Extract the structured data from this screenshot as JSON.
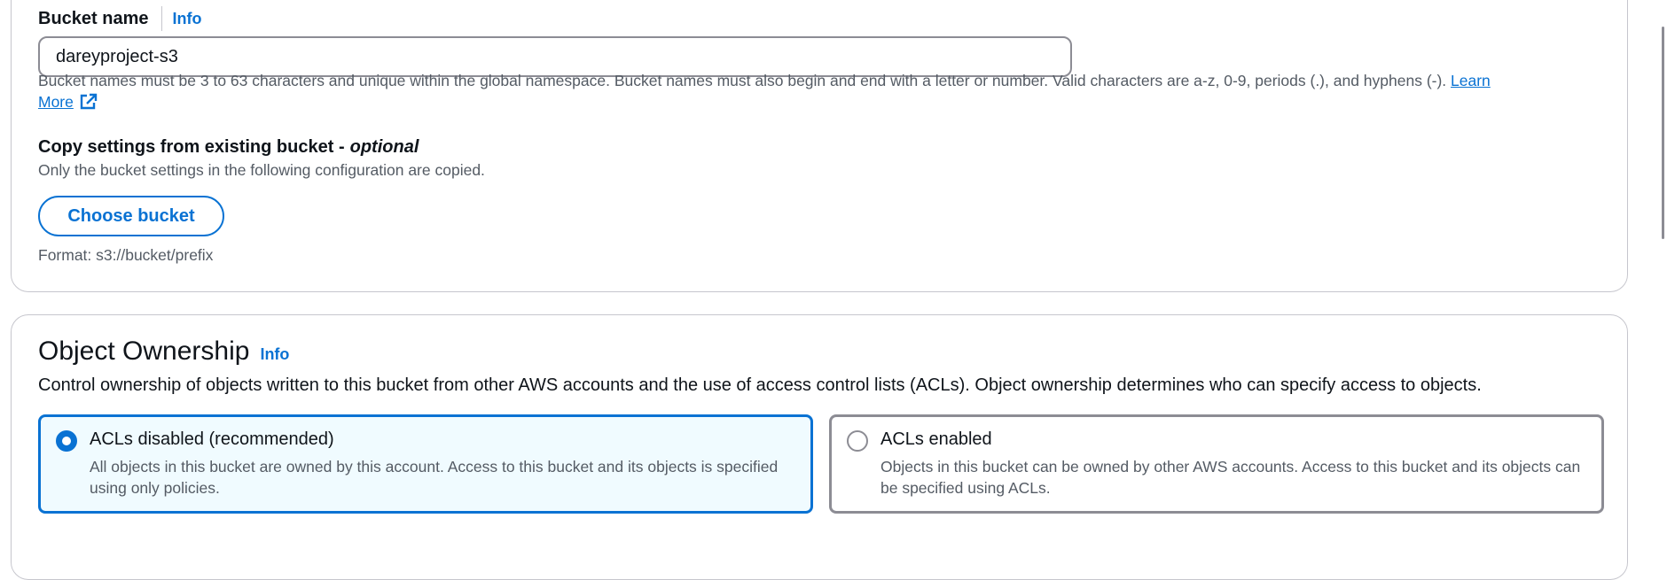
{
  "bucket_name": {
    "label": "Bucket name",
    "info": "Info",
    "value": "dareyproject-s3",
    "help_text": "Bucket names must be 3 to 63 characters and unique within the global namespace. Bucket names must also begin and end with a letter or number. Valid characters are a-z, 0-9, periods (.), and hyphens (-). ",
    "learn_more_1": "Learn",
    "learn_more_2": "More"
  },
  "copy_settings": {
    "label": "Copy settings from existing bucket - ",
    "label_optional": "optional",
    "description": "Only the bucket settings in the following configuration are copied.",
    "button": "Choose bucket",
    "format_hint": "Format: s3://bucket/prefix"
  },
  "object_ownership": {
    "title": "Object Ownership",
    "info": "Info",
    "description": "Control ownership of objects written to this bucket from other AWS accounts and the use of access control lists (ACLs). Object ownership determines who can specify access to objects.",
    "options": [
      {
        "title": "ACLs disabled (recommended)",
        "description": "All objects in this bucket are owned by this account. Access to this bucket and its objects is specified using only policies.",
        "selected": true
      },
      {
        "title": "ACLs enabled",
        "description": "Objects in this bucket can be owned by other AWS accounts. Access to this bucket and its objects can be specified using ACLs.",
        "selected": false
      }
    ]
  },
  "colors": {
    "accent": "#0972d3",
    "selected_tile_bg": "#f0fbff",
    "border": "#8c8c94",
    "text_secondary": "#545b64"
  },
  "icons": {
    "external_link": "external-link-icon"
  }
}
